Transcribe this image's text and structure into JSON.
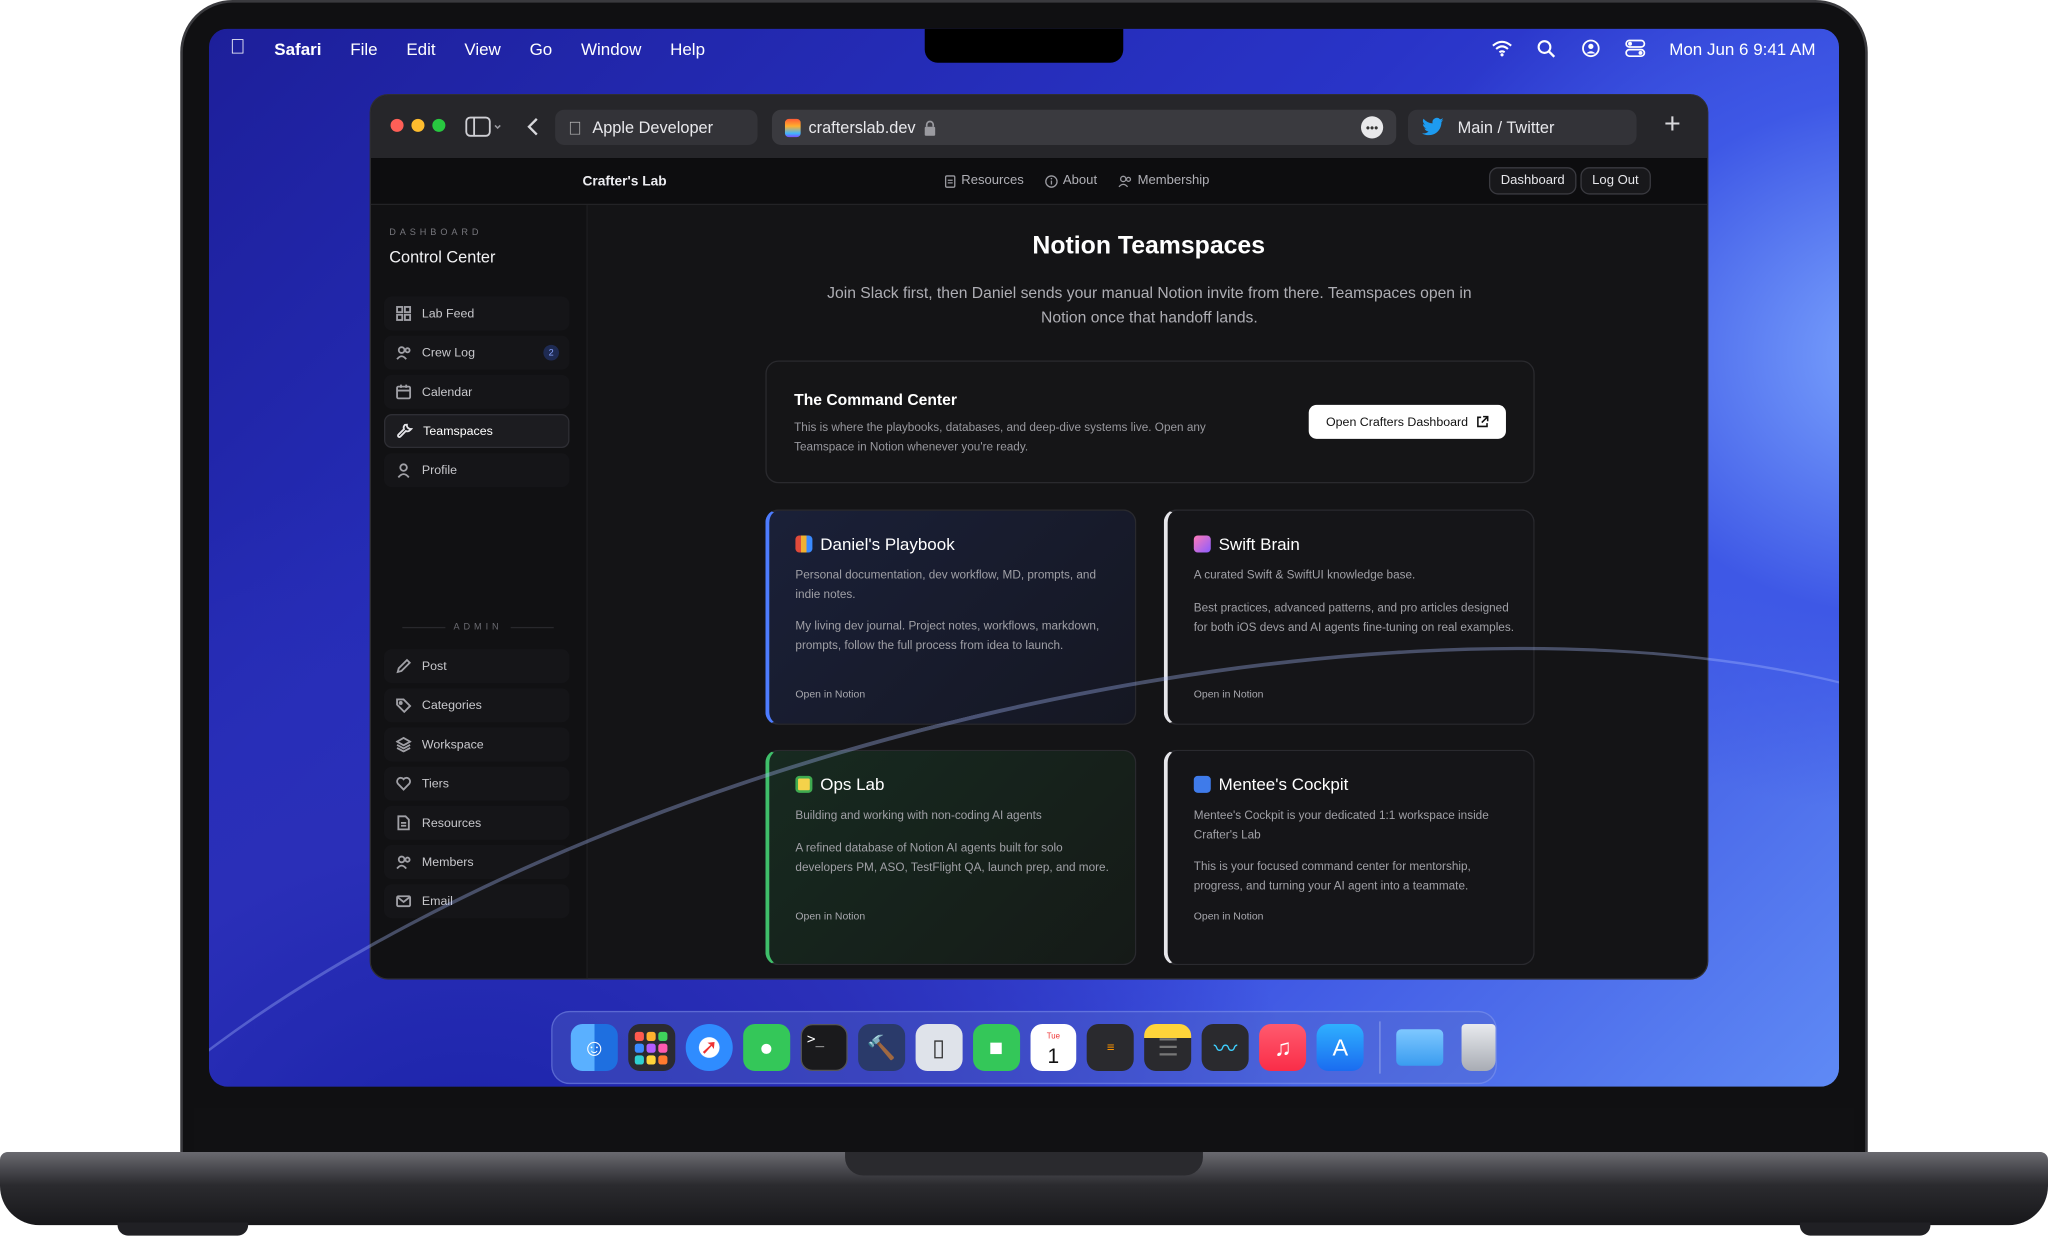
{
  "menubar": {
    "app": "Safari",
    "menus": [
      "File",
      "Edit",
      "View",
      "Go",
      "Window",
      "Help"
    ],
    "datetime": "Mon Jun 6  9:41 AM"
  },
  "browser": {
    "tabs": [
      {
        "label": "Apple Developer",
        "icon": "apple-icon"
      },
      {
        "label": "crafterslab.dev",
        "icon": "site-icon"
      },
      {
        "label": "Main / Twitter",
        "icon": "twitter-icon"
      }
    ]
  },
  "site": {
    "brand": "Crafter's Lab",
    "nav": [
      "Resources",
      "About",
      "Membership"
    ],
    "actions": {
      "dashboard": "Dashboard",
      "logout": "Log Out"
    }
  },
  "sidebar": {
    "section": "DASHBOARD",
    "title": "Control Center",
    "items": [
      {
        "label": "Lab Feed",
        "icon": "grid-icon"
      },
      {
        "label": "Crew Log",
        "icon": "users-icon",
        "badge": "2"
      },
      {
        "label": "Calendar",
        "icon": "calendar-icon"
      },
      {
        "label": "Teamspaces",
        "icon": "wrench-icon",
        "active": true
      },
      {
        "label": "Profile",
        "icon": "user-icon"
      }
    ],
    "admin_label": "ADMIN",
    "admin_items": [
      {
        "label": "Post",
        "icon": "pencil-icon"
      },
      {
        "label": "Categories",
        "icon": "tag-icon"
      },
      {
        "label": "Workspace",
        "icon": "layers-icon"
      },
      {
        "label": "Tiers",
        "icon": "heart-icon"
      },
      {
        "label": "Resources",
        "icon": "file-icon"
      },
      {
        "label": "Members",
        "icon": "users-icon"
      },
      {
        "label": "Email",
        "icon": "mail-icon"
      }
    ]
  },
  "main": {
    "title": "Notion Teamspaces",
    "intro": "Join Slack first, then Daniel sends your manual Notion invite from there. Teamspaces open in Notion once that handoff lands.",
    "command": {
      "title": "The Command Center",
      "desc": "This is where the playbooks, databases, and deep-dive systems live. Open any Teamspace in Notion whenever you're ready.",
      "button": "Open Crafters Dashboard"
    },
    "cards": [
      {
        "title": "Daniel's Playbook",
        "p1": "Personal documentation, dev workflow, MD, prompts, and indie notes.",
        "p2": "My living dev journal. Project notes, workflows, markdown, prompts, follow the full process from idea to launch.",
        "link": "Open in Notion",
        "accent": "#4d7cff"
      },
      {
        "title": "Swift Brain",
        "p1": "A curated Swift & SwiftUI knowledge base.",
        "p2": "Best practices, advanced patterns, and pro articles designed for both iOS devs and AI agents fine-tuning on real examples.",
        "link": "Open in Notion",
        "accent": "#e8e8ec"
      },
      {
        "title": "Ops Lab",
        "p1": "Building and working with non-coding AI agents",
        "p2": "A refined database of Notion AI agents built for solo developers PM, ASO, TestFlight QA, launch prep, and more.",
        "link": "Open in Notion",
        "accent": "#3fbf6a"
      },
      {
        "title": "Mentee's Cockpit",
        "p1": "Mentee's Cockpit is your dedicated 1:1 workspace inside Crafter's Lab",
        "p2": "This is your focused command center for mentorship, progress, and turning your AI agent into a teammate.",
        "link": "Open in Notion",
        "accent": "#e8e8ec"
      }
    ]
  },
  "dock": {
    "apps": [
      "finder-icon",
      "launchpad-icon",
      "safari-icon",
      "messages-icon",
      "terminal-icon",
      "xcode-icon",
      "simulator-icon",
      "facetime-icon",
      "calendar-icon",
      "reminders-icon",
      "notes-icon",
      "freeform-icon",
      "music-icon",
      "appstore-icon",
      "folder-icon",
      "trash-icon"
    ],
    "calendar_day": "1",
    "calendar_month": "Tue"
  }
}
